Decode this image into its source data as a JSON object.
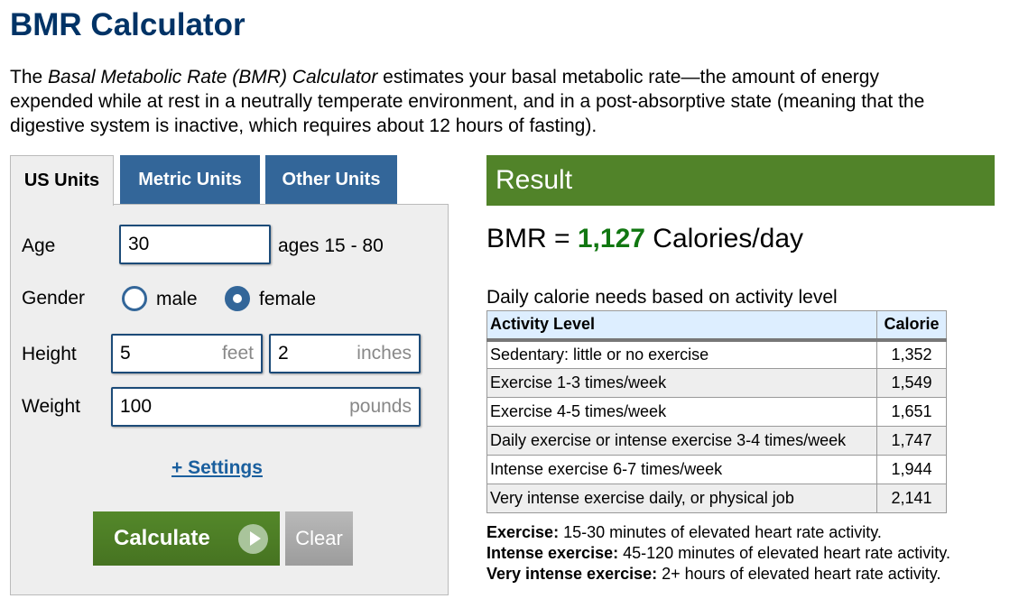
{
  "page": {
    "title": "BMR Calculator",
    "intro": {
      "prefix": "The ",
      "italic": "Basal Metabolic Rate (BMR) Calculator",
      "suffix": " estimates your basal metabolic rate—the amount of energy expended while at rest in a neutrally temperate environment, and in a post-absorptive state (meaning that the digestive system is inactive, which requires about 12 hours of fasting)."
    }
  },
  "tabs": [
    {
      "label": "US Units",
      "active": true
    },
    {
      "label": "Metric Units",
      "active": false
    },
    {
      "label": "Other Units",
      "active": false
    }
  ],
  "form": {
    "age": {
      "label": "Age",
      "value": "30",
      "hint": "ages 15 - 80"
    },
    "gender": {
      "label": "Gender",
      "options": [
        {
          "label": "male",
          "checked": false
        },
        {
          "label": "female",
          "checked": true
        }
      ]
    },
    "height": {
      "label": "Height",
      "feet_value": "5",
      "feet_unit": "feet",
      "inches_value": "2",
      "inches_unit": "inches"
    },
    "weight": {
      "label": "Weight",
      "value": "100",
      "unit": "pounds"
    },
    "settings_link": "+ Settings",
    "calculate_label": "Calculate",
    "clear_label": "Clear"
  },
  "result": {
    "header": "Result",
    "bmr_prefix": "BMR = ",
    "bmr_value": "1,127",
    "bmr_suffix": " Calories/day",
    "daily_title": "Daily calorie needs based on activity level",
    "table": {
      "headers": [
        "Activity Level",
        "Calorie"
      ],
      "rows": [
        {
          "activity": "Sedentary: little or no exercise",
          "calorie": "1,352"
        },
        {
          "activity": "Exercise 1-3 times/week",
          "calorie": "1,549"
        },
        {
          "activity": "Exercise 4-5 times/week",
          "calorie": "1,651"
        },
        {
          "activity": "Daily exercise or intense exercise 3-4 times/week",
          "calorie": "1,747"
        },
        {
          "activity": "Intense exercise 6-7 times/week",
          "calorie": "1,944"
        },
        {
          "activity": "Very intense exercise daily, or physical job",
          "calorie": "2,141"
        }
      ]
    },
    "notes": [
      {
        "term": "Exercise:",
        "text": " 15-30 minutes of elevated heart rate activity."
      },
      {
        "term": "Intense exercise:",
        "text": " 45-120 minutes of elevated heart rate activity."
      },
      {
        "term": "Very intense exercise:",
        "text": " 2+ hours of elevated heart rate activity."
      }
    ]
  },
  "colors": {
    "title": "#003366",
    "tab_inactive": "#336699",
    "result_header": "#518329",
    "bmr_value": "#117711",
    "calculate_button": "#4e7f26",
    "clear_button": "#aaaaaa",
    "link": "#1a5f9e"
  }
}
